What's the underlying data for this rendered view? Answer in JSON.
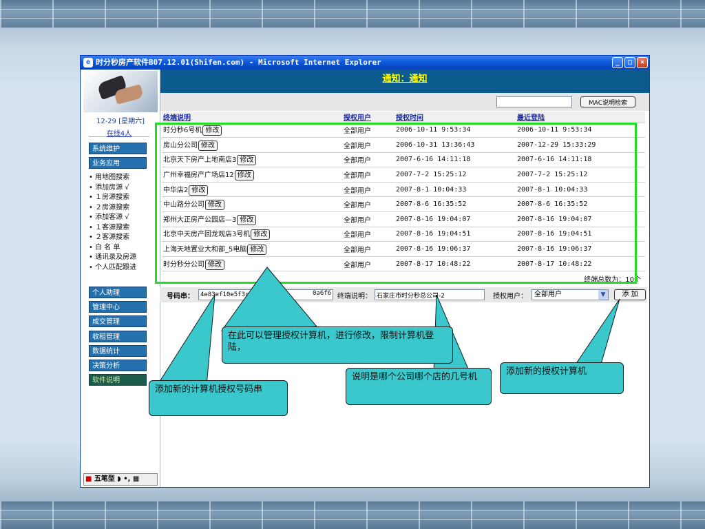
{
  "window": {
    "title": "时分秒房产软件B07.12.01(Shifen.com) - Microsoft Internet Explorer",
    "buttons": {
      "minimize": "_",
      "maximize": "□",
      "close": "×"
    }
  },
  "sidebar": {
    "date": "12-29 [星期六]",
    "online": "在线4人",
    "nav_top": [
      "系统维护",
      "业务应用"
    ],
    "sub_items": [
      "• 用地图搜索",
      "• 添加房源 √",
      "• １房源搜索",
      "• ２房源搜索",
      "• 添加客源 √",
      "• １客源搜索",
      "• ２客源搜索",
      "• 白 名 单",
      "• 通讯录及房源",
      "• 个人匹配跟进"
    ],
    "nav_bottom": [
      "个人助理",
      "管理中心",
      "成交管理",
      "收租管理",
      "数据统计",
      "决策分析",
      "软件说明"
    ],
    "ime": "五笔型"
  },
  "content": {
    "heading": "通知：通知",
    "search": {
      "value": "",
      "button": "MAC说明检索"
    },
    "columns": [
      "终端说明",
      "授权用户",
      "授权时间",
      "最近登陆"
    ],
    "edit_label": "修改",
    "rows": [
      {
        "desc": "时分秒6号机",
        "user": "全部用户",
        "auth_time": "2006-10-11 9:53:34",
        "last_login": "2006-10-11 9:53:34"
      },
      {
        "desc": "房山分公司",
        "user": "全部用户",
        "auth_time": "2006-10-31 13:36:43",
        "last_login": "2007-12-29 15:33:29"
      },
      {
        "desc": "北京天下房产上地南店3",
        "user": "全部用户",
        "auth_time": "2007-6-16 14:11:18",
        "last_login": "2007-6-16 14:11:18"
      },
      {
        "desc": "广州幸福房产广场店12",
        "user": "全部用户",
        "auth_time": "2007-7-2 15:25:12",
        "last_login": "2007-7-2 15:25:12"
      },
      {
        "desc": "中华店2",
        "user": "全部用户",
        "auth_time": "2007-8-1 10:04:33",
        "last_login": "2007-8-1 10:04:33"
      },
      {
        "desc": "中山路分公司",
        "user": "全部用户",
        "auth_time": "2007-8-6 16:35:52",
        "last_login": "2007-8-6 16:35:52"
      },
      {
        "desc": "郑州大正房产公园店—3",
        "user": "全部用户",
        "auth_time": "2007-8-16 19:04:07",
        "last_login": "2007-8-16 19:04:07"
      },
      {
        "desc": "北京中天房产回龙观店3号机",
        "user": "全部用户",
        "auth_time": "2007-8-16 19:04:51",
        "last_login": "2007-8-16 19:04:51"
      },
      {
        "desc": "上海天地置业大和部_5电脑",
        "user": "全部用户",
        "auth_time": "2007-8-16 19:06:37",
        "last_login": "2007-8-16 19:06:37"
      },
      {
        "desc": "时分秒分公司",
        "user": "全部用户",
        "auth_time": "2007-8-17 10:48:22",
        "last_login": "2007-8-17 10:48:22"
      }
    ],
    "total": "终端总数为：10个"
  },
  "form": {
    "code_label": "号码串：",
    "code_value": "4e83ef10e5f3cc86c",
    "code_suffix": "0a6f6",
    "desc_label": "终端说明：",
    "desc_value": "石家庄市时分秒总公司-2",
    "user_label": "授权用户：",
    "user_value": "全部用户",
    "add_button": "添 加"
  },
  "callouts": {
    "manage": "在此可以管理授权计算机，进行修改，限制计算机登陆，",
    "code": "添加新的计算机授权号码串",
    "desc": "说明是哪个公司哪个店的几号机",
    "add": "添加新的授权计算机"
  },
  "colors": {
    "frame_green": "#22dd22",
    "callout": "#3ac8cc",
    "heading_bg": "#0b5b8f",
    "heading_text": "#ffff00",
    "nav_bg": "#2470ad"
  }
}
